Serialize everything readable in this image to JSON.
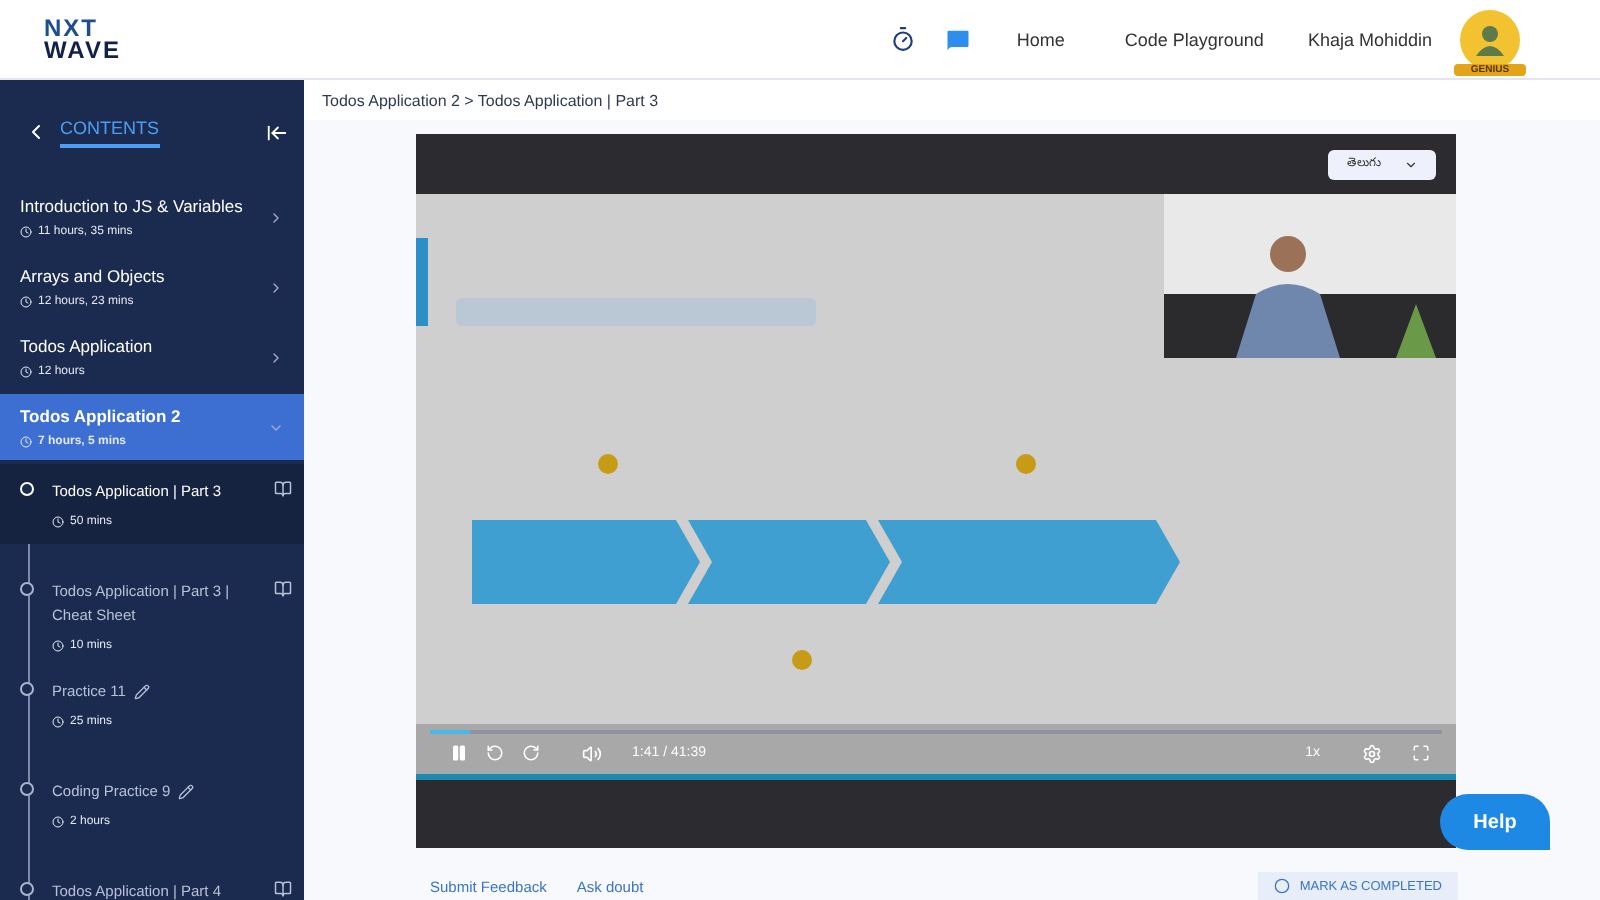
{
  "header": {
    "logo": {
      "line1": "NXT",
      "line2": "WAVE"
    },
    "nav": [
      "Home",
      "Code Playground"
    ],
    "user": {
      "name": "Khaja Mohiddin",
      "badge": "GENIUS"
    }
  },
  "sidebar": {
    "title": "CONTENTS",
    "modules": [
      {
        "title": "Introduction to JS & Variables",
        "duration": "11 hours, 35 mins",
        "selected": false,
        "expanded": false
      },
      {
        "title": "Arrays and Objects",
        "duration": "12 hours, 23 mins",
        "selected": false,
        "expanded": false
      },
      {
        "title": "Todos Application",
        "duration": "12 hours",
        "selected": false,
        "expanded": false
      },
      {
        "title": "Todos Application 2",
        "duration": "7 hours, 5 mins",
        "selected": true,
        "expanded": true,
        "children": [
          {
            "title": "Todos Application | Part 3",
            "duration": "50 mins",
            "kind": "reading",
            "selected": true
          },
          {
            "title": "Todos Application | Part 3 | Cheat Sheet",
            "duration": "10 mins",
            "kind": "reading",
            "selected": false
          },
          {
            "title": "Practice 11",
            "duration": "25 mins",
            "kind": "practice",
            "selected": false
          },
          {
            "title": "Coding Practice 9",
            "duration": "2 hours",
            "kind": "practice",
            "selected": false
          },
          {
            "title": "Todos Application | Part 4",
            "kind": "reading",
            "selected": false
          }
        ]
      }
    ]
  },
  "breadcrumb": "Todos Application 2 > Todos Application | Part 3",
  "player": {
    "language": "తెలుగు",
    "playing": true,
    "level": 0.04,
    "time": "1:41 / 41:39",
    "speed": "1x"
  },
  "footer": {
    "links": [
      "Submit Feedback",
      "Ask doubt"
    ],
    "mark_completed": {
      "label": "MARK AS COMPLETED",
      "checked": false
    }
  },
  "help": "Help"
}
